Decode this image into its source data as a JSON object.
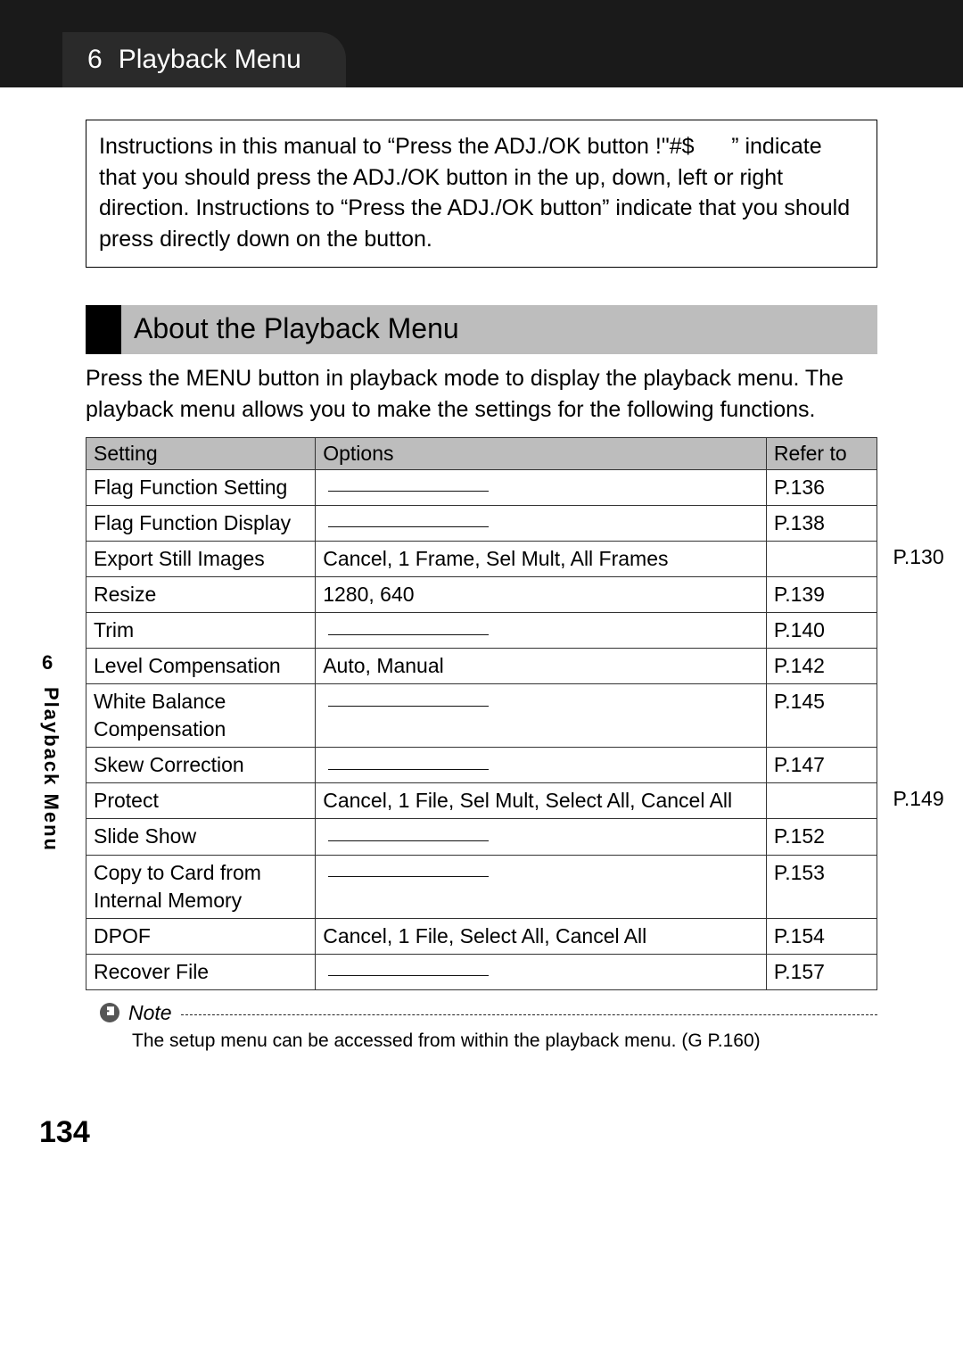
{
  "header": {
    "chapter_number": "6",
    "chapter_title": "Playback Menu"
  },
  "instruction_box": "Instructions in this manual to “Press the ADJ./OK button !\"#$      ” indicate that you should press the ADJ./OK button in the up, down, left or right direction. Instructions to “Press the ADJ./OK button” indicate that you should press directly down on the button.",
  "section": {
    "title": "About the Playback Menu",
    "intro": "Press the MENU button in playback mode to display the playback menu. The playback menu allows you to make the settings for the following functions."
  },
  "table": {
    "headers": {
      "setting": "Setting",
      "options": "Options",
      "refer": "Refer to"
    },
    "rows": [
      {
        "setting": "Flag Function Setting",
        "options": "",
        "refer": "P.136",
        "overflow": false
      },
      {
        "setting": "Flag Function Display",
        "options": "",
        "refer": "P.138",
        "overflow": false
      },
      {
        "setting": "Export Still Images",
        "options": "Cancel, 1 Frame, Sel Mult, All Frames",
        "refer": "P.130",
        "overflow": true
      },
      {
        "setting": "Resize",
        "options": "1280, 640",
        "refer": "P.139",
        "overflow": false
      },
      {
        "setting": "Trim",
        "options": "",
        "refer": "P.140",
        "overflow": false
      },
      {
        "setting": "Level Compensation",
        "options": "Auto, Manual",
        "refer": "P.142",
        "overflow": false
      },
      {
        "setting": "White Balance Compensation",
        "options": "",
        "refer": "P.145",
        "overflow": false
      },
      {
        "setting": "Skew Correction",
        "options": "",
        "refer": "P.147",
        "overflow": false
      },
      {
        "setting": "Protect",
        "options": "Cancel, 1 File, Sel Mult, Select All, Cancel All",
        "refer": "P.149",
        "overflow": true
      },
      {
        "setting": "Slide Show",
        "options": "",
        "refer": "P.152",
        "overflow": false
      },
      {
        "setting": "Copy to Card from Internal Memory",
        "options": "",
        "refer": "P.153",
        "overflow": false
      },
      {
        "setting": "DPOF",
        "options": "Cancel, 1 File, Select All, Cancel All",
        "refer": "P.154",
        "overflow": false
      },
      {
        "setting": "Recover File",
        "options": "",
        "refer": "P.157",
        "overflow": false
      }
    ]
  },
  "note": {
    "label": "Note",
    "text": "The setup menu can be accessed from within the playback menu. (G P.160)"
  },
  "margin": {
    "section_number": "6",
    "section_label": "Playback Menu"
  },
  "page_number": "134"
}
